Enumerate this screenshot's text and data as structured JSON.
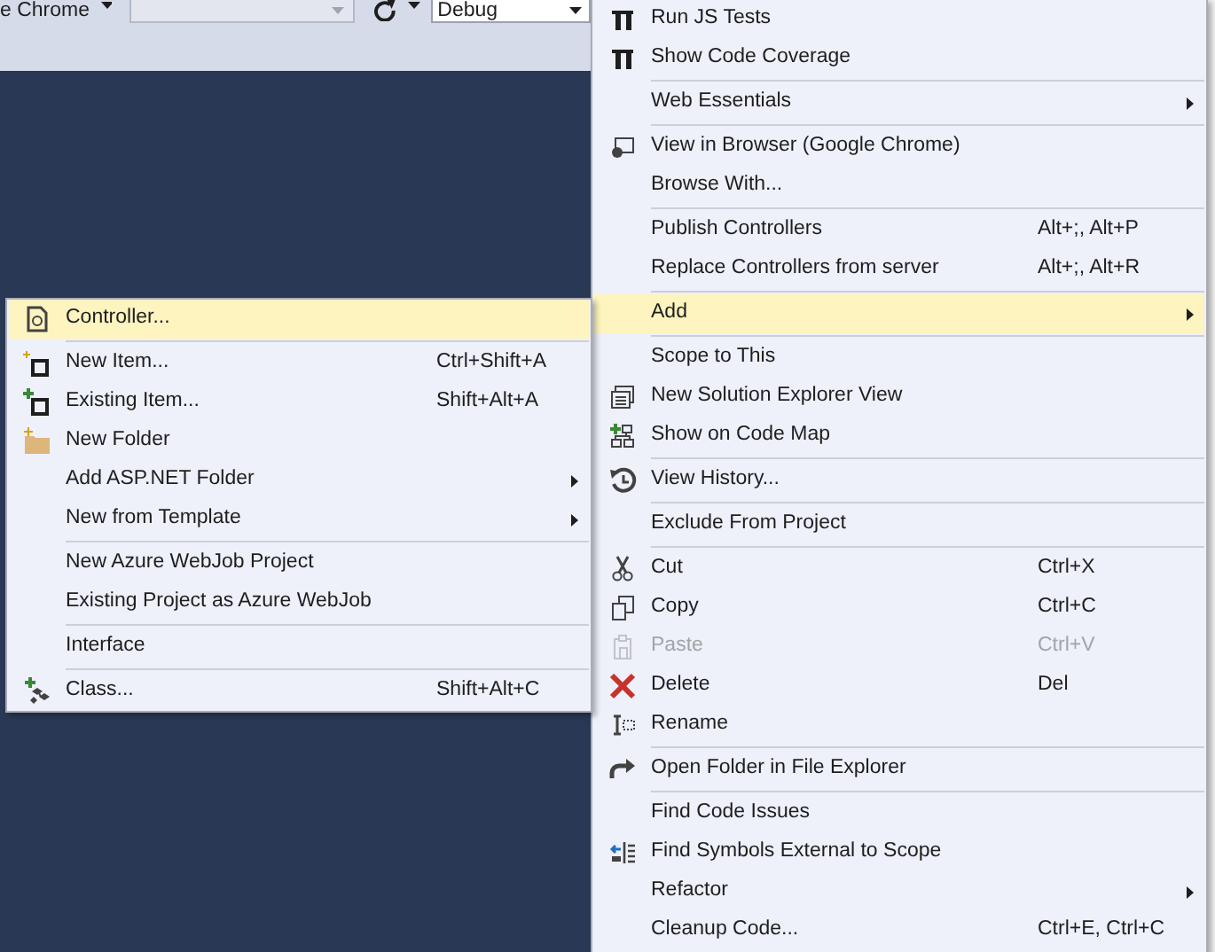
{
  "toolbar": {
    "browser_label": "e Chrome",
    "config_field": "Debug"
  },
  "context_menu": {
    "items": [
      {
        "kind": "item",
        "label": "Run JS Tests",
        "selected": false,
        "disabled": false,
        "has_submenu": false
      },
      {
        "kind": "item",
        "label": "Show Code Coverage",
        "selected": false,
        "disabled": false,
        "has_submenu": false
      },
      {
        "kind": "separator"
      },
      {
        "kind": "item",
        "label": "Web Essentials",
        "selected": false,
        "disabled": false,
        "has_submenu": true
      },
      {
        "kind": "separator"
      },
      {
        "kind": "item",
        "label": "View in Browser (Google Chrome)",
        "selected": false,
        "disabled": false,
        "has_submenu": false
      },
      {
        "kind": "item",
        "label": "Browse With...",
        "selected": false,
        "disabled": false,
        "has_submenu": false
      },
      {
        "kind": "separator"
      },
      {
        "kind": "item",
        "label": "Publish Controllers",
        "shortcut": "Alt+;, Alt+P",
        "selected": false,
        "disabled": false,
        "has_submenu": false
      },
      {
        "kind": "item",
        "label": "Replace Controllers from server",
        "shortcut": "Alt+;, Alt+R",
        "selected": false,
        "disabled": false,
        "has_submenu": false
      },
      {
        "kind": "separator"
      },
      {
        "kind": "item",
        "label": "Add",
        "selected": true,
        "disabled": false,
        "has_submenu": true
      },
      {
        "kind": "separator"
      },
      {
        "kind": "item",
        "label": "Scope to This",
        "selected": false,
        "disabled": false,
        "has_submenu": false
      },
      {
        "kind": "item",
        "label": "New Solution Explorer View",
        "selected": false,
        "disabled": false,
        "has_submenu": false
      },
      {
        "kind": "item",
        "label": "Show on Code Map",
        "selected": false,
        "disabled": false,
        "has_submenu": false
      },
      {
        "kind": "separator"
      },
      {
        "kind": "item",
        "label": "View History...",
        "selected": false,
        "disabled": false,
        "has_submenu": false
      },
      {
        "kind": "separator"
      },
      {
        "kind": "item",
        "label": "Exclude From Project",
        "selected": false,
        "disabled": false,
        "has_submenu": false
      },
      {
        "kind": "separator"
      },
      {
        "kind": "item",
        "label": "Cut",
        "shortcut": "Ctrl+X",
        "selected": false,
        "disabled": false,
        "has_submenu": false
      },
      {
        "kind": "item",
        "label": "Copy",
        "shortcut": "Ctrl+C",
        "selected": false,
        "disabled": false,
        "has_submenu": false
      },
      {
        "kind": "item",
        "label": "Paste",
        "shortcut": "Ctrl+V",
        "selected": false,
        "disabled": true,
        "has_submenu": false
      },
      {
        "kind": "item",
        "label": "Delete",
        "shortcut": "Del",
        "selected": false,
        "disabled": false,
        "has_submenu": false
      },
      {
        "kind": "item",
        "label": "Rename",
        "selected": false,
        "disabled": false,
        "has_submenu": false
      },
      {
        "kind": "separator"
      },
      {
        "kind": "item",
        "label": "Open Folder in File Explorer",
        "selected": false,
        "disabled": false,
        "has_submenu": false
      },
      {
        "kind": "separator"
      },
      {
        "kind": "item",
        "label": "Find Code Issues",
        "selected": false,
        "disabled": false,
        "has_submenu": false
      },
      {
        "kind": "item",
        "label": "Find Symbols External to Scope",
        "selected": false,
        "disabled": false,
        "has_submenu": false
      },
      {
        "kind": "item",
        "label": "Refactor",
        "selected": false,
        "disabled": false,
        "has_submenu": true
      },
      {
        "kind": "item",
        "label": "Cleanup Code...",
        "shortcut": "Ctrl+E, Ctrl+C",
        "selected": false,
        "disabled": false,
        "has_submenu": false
      }
    ]
  },
  "add_submenu": {
    "items": [
      {
        "kind": "item",
        "label": "Controller...",
        "selected": true,
        "disabled": false,
        "has_submenu": false
      },
      {
        "kind": "separator"
      },
      {
        "kind": "item",
        "label": "New Item...",
        "shortcut": "Ctrl+Shift+A",
        "selected": false,
        "disabled": false,
        "has_submenu": false
      },
      {
        "kind": "item",
        "label": "Existing Item...",
        "shortcut": "Shift+Alt+A",
        "selected": false,
        "disabled": false,
        "has_submenu": false
      },
      {
        "kind": "item",
        "label": "New Folder",
        "selected": false,
        "disabled": false,
        "has_submenu": false
      },
      {
        "kind": "item",
        "label": "Add ASP.NET Folder",
        "selected": false,
        "disabled": false,
        "has_submenu": true
      },
      {
        "kind": "item",
        "label": "New from Template",
        "selected": false,
        "disabled": false,
        "has_submenu": true
      },
      {
        "kind": "separator"
      },
      {
        "kind": "item",
        "label": "New Azure WebJob Project",
        "selected": false,
        "disabled": false,
        "has_submenu": false
      },
      {
        "kind": "item",
        "label": "Existing Project as Azure WebJob",
        "selected": false,
        "disabled": false,
        "has_submenu": false
      },
      {
        "kind": "separator"
      },
      {
        "kind": "item",
        "label": "Interface",
        "selected": false,
        "disabled": false,
        "has_submenu": false
      },
      {
        "kind": "separator"
      },
      {
        "kind": "item",
        "label": "Class...",
        "shortcut": "Shift+Alt+C",
        "selected": false,
        "disabled": false,
        "has_submenu": false
      }
    ]
  }
}
